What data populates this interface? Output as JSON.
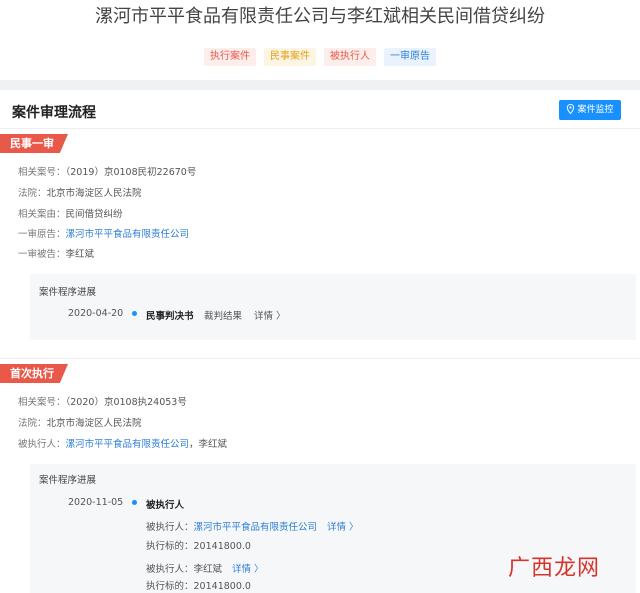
{
  "header": {
    "title": "漯河市平平食品有限责任公司与李红斌相关民间借贷纠纷",
    "tags": [
      {
        "label": "执行案件",
        "color": "#e8594a",
        "bg": "#fdeeec"
      },
      {
        "label": "民事案件",
        "color": "#e3a11a",
        "bg": "#fdf5e3"
      },
      {
        "label": "被执行人",
        "color": "#e8594a",
        "bg": "#fdeeec"
      },
      {
        "label": "一审原告",
        "color": "#2f7fd6",
        "bg": "#eaf3fd"
      }
    ]
  },
  "section": {
    "title": "案件审理流程",
    "monitor_button": "案件监控"
  },
  "stage1": {
    "badge": "民事一审",
    "case_no_label": "相关案号：",
    "case_no": "（2019）京0108民初22670号",
    "court_label": "法院：",
    "court": "北京市海淀区人民法院",
    "cause_label": "相关案由：",
    "cause": "民间借贷纠纷",
    "plaintiff_label": "一审原告：",
    "plaintiff": "漯河市平平食品有限责任公司",
    "defendant_label": "一审被告：",
    "defendant": "李红斌",
    "progress_title": "案件程序进展",
    "progress": {
      "date": "2020-04-20",
      "doc": "民事判决书",
      "result_link": "裁判结果",
      "detail_link": "详情 〉"
    }
  },
  "stage2": {
    "badge": "首次执行",
    "case_no_label": "相关案号：",
    "case_no": "（2020）京0108执24053号",
    "court_label": "法院：",
    "court": "北京市海淀区人民法院",
    "executed_label": "被执行人：",
    "executed_company": "漯河市平平食品有限责任公司",
    "executed_sep": "，",
    "executed_person": "李红斌",
    "progress_title": "案件程序进展",
    "progress": {
      "date": "2020-11-05",
      "heading": "被执行人",
      "entry1_label": "被执行人：",
      "entry1_value": "漯河市平平食品有限责任公司",
      "entry1_link": "详情 〉",
      "entry1_amount_label": "执行标的：",
      "entry1_amount": "20141800.0",
      "entry2_label": "被执行人：",
      "entry2_value": "李红斌",
      "entry2_link": "详情 〉",
      "entry2_amount_label": "执行标的：",
      "entry2_amount": "20141800.0"
    }
  },
  "watermark": "广西龙网"
}
